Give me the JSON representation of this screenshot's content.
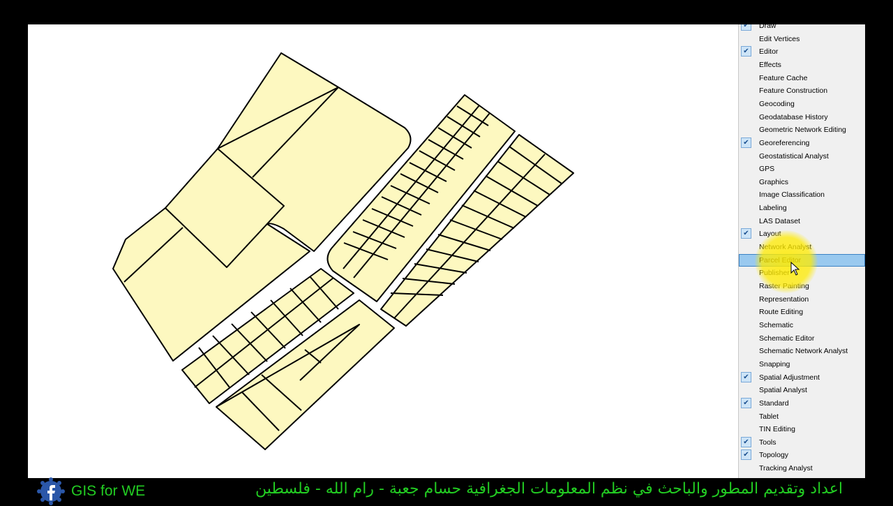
{
  "menu": {
    "items": [
      {
        "label": "Draw",
        "checked": true
      },
      {
        "label": "Edit Vertices",
        "checked": false
      },
      {
        "label": "Editor",
        "checked": true
      },
      {
        "label": "Effects",
        "checked": false
      },
      {
        "label": "Feature Cache",
        "checked": false
      },
      {
        "label": "Feature Construction",
        "checked": false
      },
      {
        "label": "Geocoding",
        "checked": false
      },
      {
        "label": "Geodatabase History",
        "checked": false
      },
      {
        "label": "Geometric Network Editing",
        "checked": false
      },
      {
        "label": "Georeferencing",
        "checked": true
      },
      {
        "label": "Geostatistical Analyst",
        "checked": false
      },
      {
        "label": "GPS",
        "checked": false
      },
      {
        "label": "Graphics",
        "checked": false
      },
      {
        "label": "Image Classification",
        "checked": false
      },
      {
        "label": "Labeling",
        "checked": false
      },
      {
        "label": "LAS Dataset",
        "checked": false
      },
      {
        "label": "Layout",
        "checked": true
      },
      {
        "label": "Network Analyst",
        "checked": false
      },
      {
        "label": "Parcel Editor",
        "checked": false,
        "selected": true
      },
      {
        "label": "Publisher",
        "checked": false
      },
      {
        "label": "Raster Painting",
        "checked": false
      },
      {
        "label": "Representation",
        "checked": false
      },
      {
        "label": "Route Editing",
        "checked": false
      },
      {
        "label": "Schematic",
        "checked": false
      },
      {
        "label": "Schematic Editor",
        "checked": false
      },
      {
        "label": "Schematic Network Analyst",
        "checked": false
      },
      {
        "label": "Snapping",
        "checked": false
      },
      {
        "label": "Spatial Adjustment",
        "checked": true
      },
      {
        "label": "Spatial Analyst",
        "checked": false
      },
      {
        "label": "Standard",
        "checked": true
      },
      {
        "label": "Tablet",
        "checked": false
      },
      {
        "label": "TIN Editing",
        "checked": false
      },
      {
        "label": "Tools",
        "checked": true
      },
      {
        "label": "Topology",
        "checked": true
      },
      {
        "label": "Tracking Analyst",
        "checked": false
      }
    ]
  },
  "footer": {
    "brand": "GIS for WE",
    "credit": "اعداد وتقديم المطور والباحث في نظم المعلومات الجغرافية حسام جعبة - رام الله - فلسطين"
  },
  "colors": {
    "parcel_fill": "#fdf8c0",
    "parcel_stroke": "#000000",
    "selection": "#99c9ef",
    "footer_text": "#22cc22"
  },
  "icons": {
    "check": "check-icon",
    "cursor": "mouse-pointer-icon",
    "facebook": "facebook-icon"
  }
}
